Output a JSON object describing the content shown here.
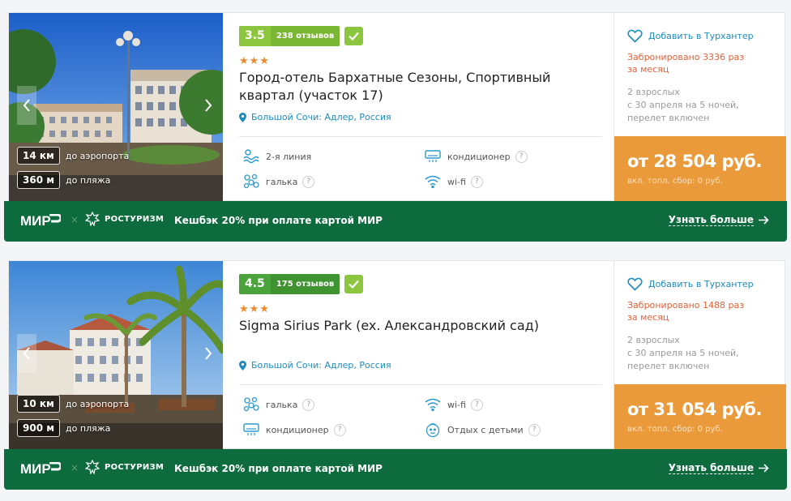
{
  "colors": {
    "rating_green_light": "#8cc63f",
    "rating_green_dark": "#4aa33b",
    "accent_orange": "#ea9a3a",
    "link_blue": "#1c8cbf",
    "promo_green": "#0d6b3e",
    "booked_red": "#e4623a"
  },
  "common": {
    "add_favorite": "Добавить в Турхантер",
    "trip_line1": "2 взрослых",
    "trip_line2": "с 30 апреля на 5 ночей,",
    "trip_line3": "перелет включен",
    "fee_note": "вкл. топл. сбор: 0 руб.",
    "mir": "МИР",
    "promo_separator": "×",
    "rosturizm": "РОСТУРИЗМ",
    "cashback": "Кешбэк 20% при оплате картой МИР",
    "learn_more": "Узнать больше",
    "airport_label": "до аэропорта",
    "beach_label": "до пляжа",
    "q_mark": "?"
  },
  "hotels": [
    {
      "rating": "3.5",
      "reviews": "238 отзывов",
      "stars": "★★★",
      "name": "Город-отель Бархатные Сезоны, Спортивный квартал (участок 17)",
      "location": "Большой Сочи: Адлер, Россия",
      "airport_dist": "14 км",
      "beach_dist": "360 м",
      "features": [
        {
          "icon": "sea-line-icon",
          "label": "2-я линия",
          "help": false
        },
        {
          "icon": "air-conditioner-icon",
          "label": "кондиционер",
          "help": true
        },
        {
          "icon": "pebble-icon",
          "label": "галька",
          "help": true
        },
        {
          "icon": "wifi-icon",
          "label": "wi-fi",
          "help": true
        }
      ],
      "booked_line1": "Забронировано 3336 раз",
      "booked_line2": "за месяц",
      "price": "от 28 504 руб."
    },
    {
      "rating": "4.5",
      "reviews": "175 отзывов",
      "stars": "★★★",
      "name": "Sigma Sirius Park (ex. Александровский сад)",
      "location": "Большой Сочи: Адлер, Россия",
      "airport_dist": "10 км",
      "beach_dist": "900 м",
      "features": [
        {
          "icon": "pebble-icon",
          "label": "галька",
          "help": true
        },
        {
          "icon": "wifi-icon",
          "label": "wi-fi",
          "help": true
        },
        {
          "icon": "air-conditioner-icon",
          "label": "кондиционер",
          "help": true
        },
        {
          "icon": "kids-icon",
          "label": "Отдых с детьми",
          "help": true
        }
      ],
      "booked_line1": "Забронировано 1488 раз",
      "booked_line2": "за месяц",
      "price": "от 31 054 руб."
    }
  ]
}
